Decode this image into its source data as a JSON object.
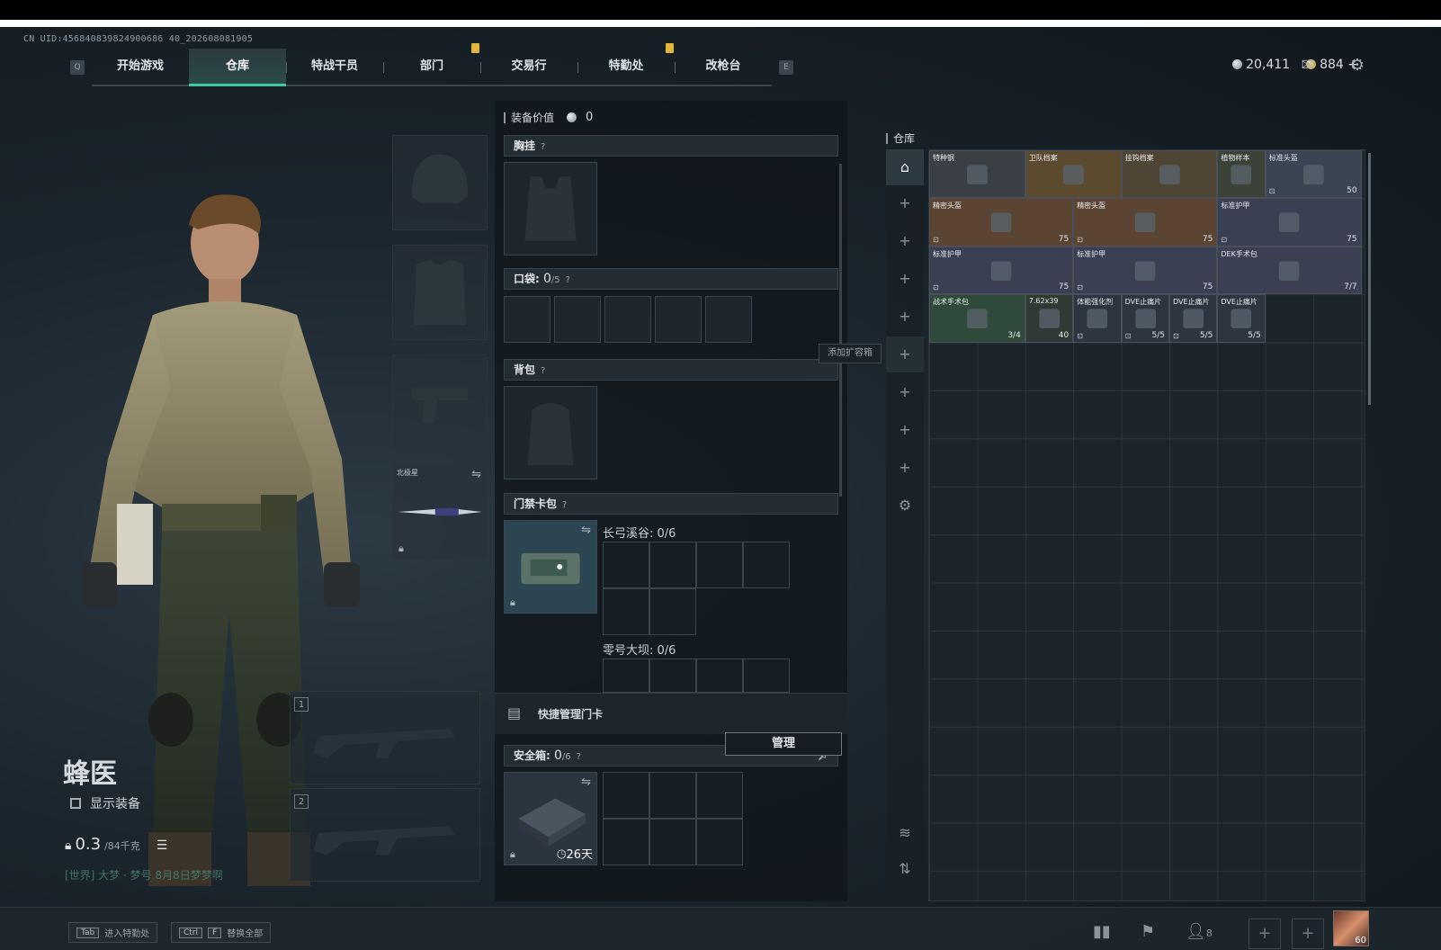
{
  "uid": "CN UID:456840839824900686 40_202608081905",
  "nav": {
    "key_left": "Q",
    "key_right": "E",
    "tabs": [
      {
        "label": "开始游戏"
      },
      {
        "label": "仓库",
        "active": true
      },
      {
        "label": "特战干员"
      },
      {
        "label": "部门"
      },
      {
        "label": "交易行"
      },
      {
        "label": "特勤处"
      },
      {
        "label": "改枪台"
      }
    ]
  },
  "currency": {
    "silver": "20,411",
    "gold": "884",
    "gold_plus": "+"
  },
  "character": {
    "name": "蜂医",
    "show_equipment_label": "显示装备",
    "weight_value": "0.3",
    "weight_unit": "/84千克",
    "chat_line": "[世界] 大梦 · 梦号 8月8日梦梦啊"
  },
  "gear_slots": {
    "melee_label": "北极星"
  },
  "weapon_slots": [
    "1",
    "2"
  ],
  "equipment": {
    "value_label": "装备价值",
    "value": "0",
    "chest_rig_label": "胸挂",
    "pockets_label": "口袋:",
    "pockets_count": "0",
    "pockets_total": "/5",
    "backpack_label": "背包",
    "keycard_label": "门禁卡包",
    "keycard_zone1": "长弓溪谷: 0/6",
    "keycard_zone2": "零号大坝: 0/6",
    "quick_manage_label": "快捷管理门卡",
    "manage_button": "管理",
    "safebox_label": "安全箱:",
    "safebox_count": "0",
    "safebox_total": "/6",
    "safebox_days": "26天",
    "add_container": "添加扩容箱",
    "help": "?"
  },
  "warehouse": {
    "title": "仓库",
    "items": [
      {
        "name": "特种钢",
        "val": "",
        "tag": "",
        "color": "#3a3f45"
      },
      {
        "name": "卫队档案",
        "val": "",
        "tag": "",
        "color": "#5b4a2e"
      },
      {
        "name": "挂钩档案",
        "val": "",
        "tag": "",
        "color": "#4f4535"
      },
      {
        "name": "植物样本",
        "val": "",
        "tag": "",
        "color": "#3b4339"
      },
      {
        "name": "标准头盔",
        "val": "50",
        "tag": "⊡",
        "color": "#3a4452"
      },
      {
        "name": "精密头盔",
        "val": "75",
        "tag": "⊡",
        "color": "#5c4432"
      },
      {
        "name": "精密头盔",
        "val": "75",
        "tag": "⊡",
        "color": "#5c4432"
      },
      {
        "name": "标准护甲",
        "val": "75",
        "tag": "⊡",
        "color": "#3b3f54"
      },
      {
        "name": "标准护甲",
        "val": "75",
        "tag": "⊡",
        "color": "#3b3f54"
      },
      {
        "name": "标准护甲",
        "val": "75",
        "tag": "⊡",
        "color": "#3b3f54"
      },
      {
        "name": "DEK手术包",
        "val": "7/7",
        "tag": "",
        "color": "#3b3f54"
      },
      {
        "name": "战术手术包",
        "val": "3/4",
        "tag": "",
        "color": "#2f4a3b"
      },
      {
        "name": "7.62x39",
        "val": "40",
        "tag": "",
        "color": "#2f3a34"
      },
      {
        "name": "体能强化剂",
        "val": "",
        "tag": "⊡",
        "color": "#2c3540"
      },
      {
        "name": "DVE止痛片",
        "val": "5/5",
        "tag": "⊡",
        "color": "#2c3540"
      },
      {
        "name": "DVE止痛片",
        "val": "5/5",
        "tag": "⊡",
        "color": "#2c3540"
      },
      {
        "name": "DVE止痛片",
        "val": "5/5",
        "tag": "",
        "color": "#2c3540"
      }
    ]
  },
  "bottombar": {
    "hint1_key": "Tab",
    "hint1_text": "进入特勤处",
    "hint2_key1": "Ctrl",
    "hint2_key2": "F",
    "hint2_text": "替换全部",
    "friends_count": "8",
    "level": "60"
  }
}
